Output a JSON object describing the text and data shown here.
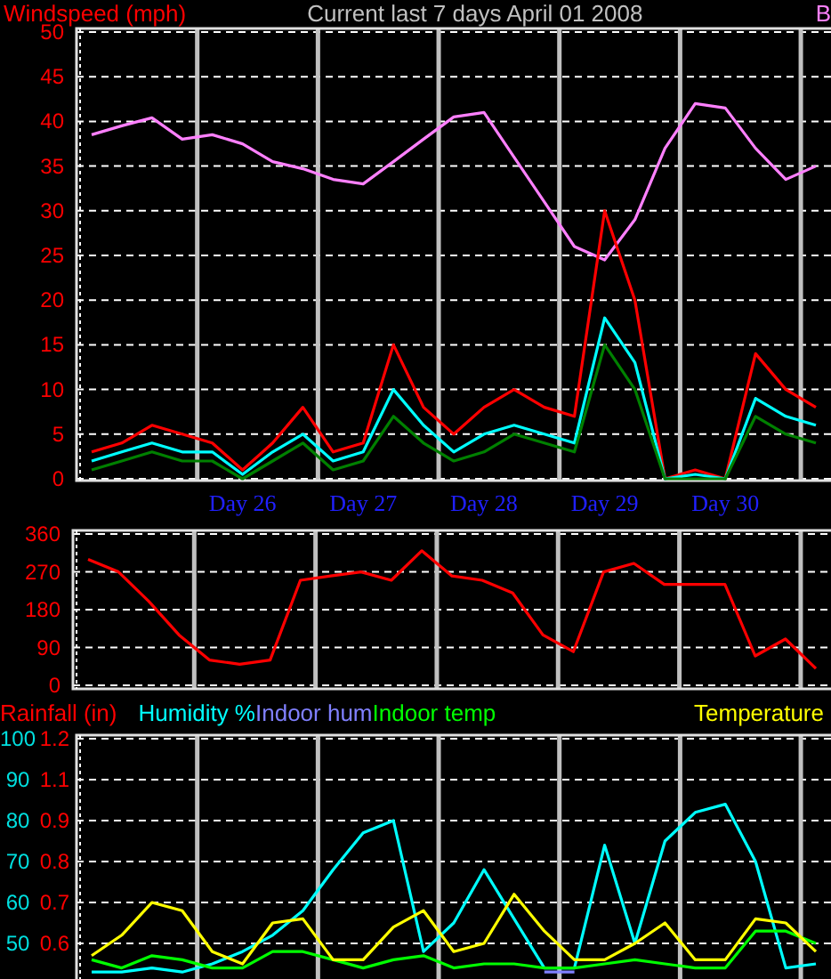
{
  "wind_panel": {
    "label": "Windspeed (mph)",
    "title": "Current last 7 days April 01 2008",
    "right_label": "B",
    "chart_data": {
      "type": "line",
      "categories": [
        null,
        null,
        null,
        null,
        null,
        "Day 26",
        null,
        null,
        null,
        "Day 27",
        null,
        null,
        null,
        "Day 28",
        null,
        null,
        null,
        "Day 29",
        null,
        null,
        null,
        "Day 30",
        null,
        null,
        null
      ],
      "grid": true,
      "ylim": [
        0,
        50
      ],
      "yticks": [
        0,
        5,
        10,
        15,
        20,
        25,
        30,
        35,
        40,
        45,
        50
      ],
      "series": [
        {
          "color": "#ff80ff",
          "values": [
            38.5,
            39.5,
            40.4,
            38,
            38.5,
            37.5,
            35.5,
            34.7,
            33.5,
            33,
            35.5,
            38,
            40.5,
            41,
            36,
            31,
            26,
            24.5,
            29,
            37,
            42,
            41.5,
            37,
            33.5,
            35
          ]
        },
        {
          "color": "#ff0000",
          "values": [
            3,
            4,
            6,
            5,
            4,
            1,
            4,
            8,
            3,
            4,
            15,
            8,
            5,
            8,
            10,
            8,
            7,
            30,
            20,
            0,
            1,
            0,
            14,
            10,
            8
          ]
        },
        {
          "color": "#00ffff",
          "values": [
            2,
            3,
            4,
            3,
            3,
            0.5,
            3,
            5,
            2,
            3,
            10,
            6,
            3,
            5,
            6,
            5,
            4,
            18,
            13,
            0,
            0.5,
            0,
            9,
            7,
            6
          ]
        },
        {
          "color": "#008000",
          "values": [
            1,
            2,
            3,
            2,
            2,
            0,
            2,
            4,
            1,
            2,
            7,
            4,
            2,
            3,
            5,
            4,
            3,
            15,
            10,
            0,
            0,
            0,
            7,
            5,
            4
          ]
        }
      ]
    }
  },
  "direction_panel": {
    "chart_data": {
      "type": "line",
      "categories": [
        null,
        null,
        null,
        null,
        null,
        null,
        null,
        null,
        null,
        null,
        null,
        null,
        null,
        null,
        null,
        null,
        null,
        null,
        null,
        null,
        null,
        null,
        null,
        null,
        null
      ],
      "grid": true,
      "ylim": [
        0,
        360
      ],
      "yticks": [
        0,
        90,
        180,
        270,
        360
      ],
      "series": [
        {
          "color": "#ff0000",
          "values": [
            300,
            270,
            200,
            120,
            60,
            50,
            60,
            250,
            260,
            270,
            250,
            320,
            260,
            250,
            220,
            120,
            80,
            270,
            290,
            240,
            240,
            240,
            70,
            110,
            40
          ]
        }
      ]
    }
  },
  "climate_panel": {
    "rainfall_label": "Rainfall (in)",
    "rainfall_ticks": [
      "1.2",
      "1.1",
      "0.9",
      "0.8",
      "0.7",
      "0.6"
    ],
    "chart_data": {
      "type": "line",
      "categories": [
        null,
        null,
        null,
        null,
        null,
        null,
        null,
        null,
        null,
        null,
        null,
        null,
        null,
        null,
        null,
        null,
        null,
        null,
        null,
        null,
        null,
        null,
        null,
        null,
        null
      ],
      "grid": true,
      "ylim": [
        38,
        100
      ],
      "yticks": [
        50,
        60,
        70,
        80,
        90,
        100
      ],
      "series": [
        {
          "name": "Humidity %",
          "color": "#00ffff",
          "values": [
            43,
            43,
            44,
            43,
            45,
            48,
            52,
            58,
            68,
            77,
            80,
            48,
            55,
            68,
            56,
            44,
            44,
            74,
            50,
            75,
            82,
            84,
            70,
            44,
            45
          ]
        },
        {
          "name": "Indoor hum",
          "color": "#8080ff",
          "values": [
            null,
            null,
            null,
            null,
            null,
            null,
            null,
            null,
            null,
            null,
            null,
            null,
            null,
            null,
            null,
            43,
            43,
            null,
            null,
            null,
            null,
            null,
            null,
            null,
            null
          ]
        },
        {
          "name": "Indoor temp",
          "color": "#00ff00",
          "values": [
            46,
            44,
            47,
            46,
            44,
            44,
            48,
            48,
            46,
            44,
            46,
            47,
            44,
            45,
            45,
            44,
            44,
            45,
            46,
            45,
            44,
            44,
            53,
            53,
            50
          ]
        },
        {
          "name": "Temperature",
          "color": "#ffff00",
          "values": [
            47,
            52,
            60,
            58,
            48,
            45,
            55,
            56,
            46,
            46,
            54,
            58,
            48,
            50,
            62,
            53,
            46,
            46,
            50,
            55,
            46,
            46,
            56,
            55,
            48
          ]
        }
      ]
    }
  }
}
